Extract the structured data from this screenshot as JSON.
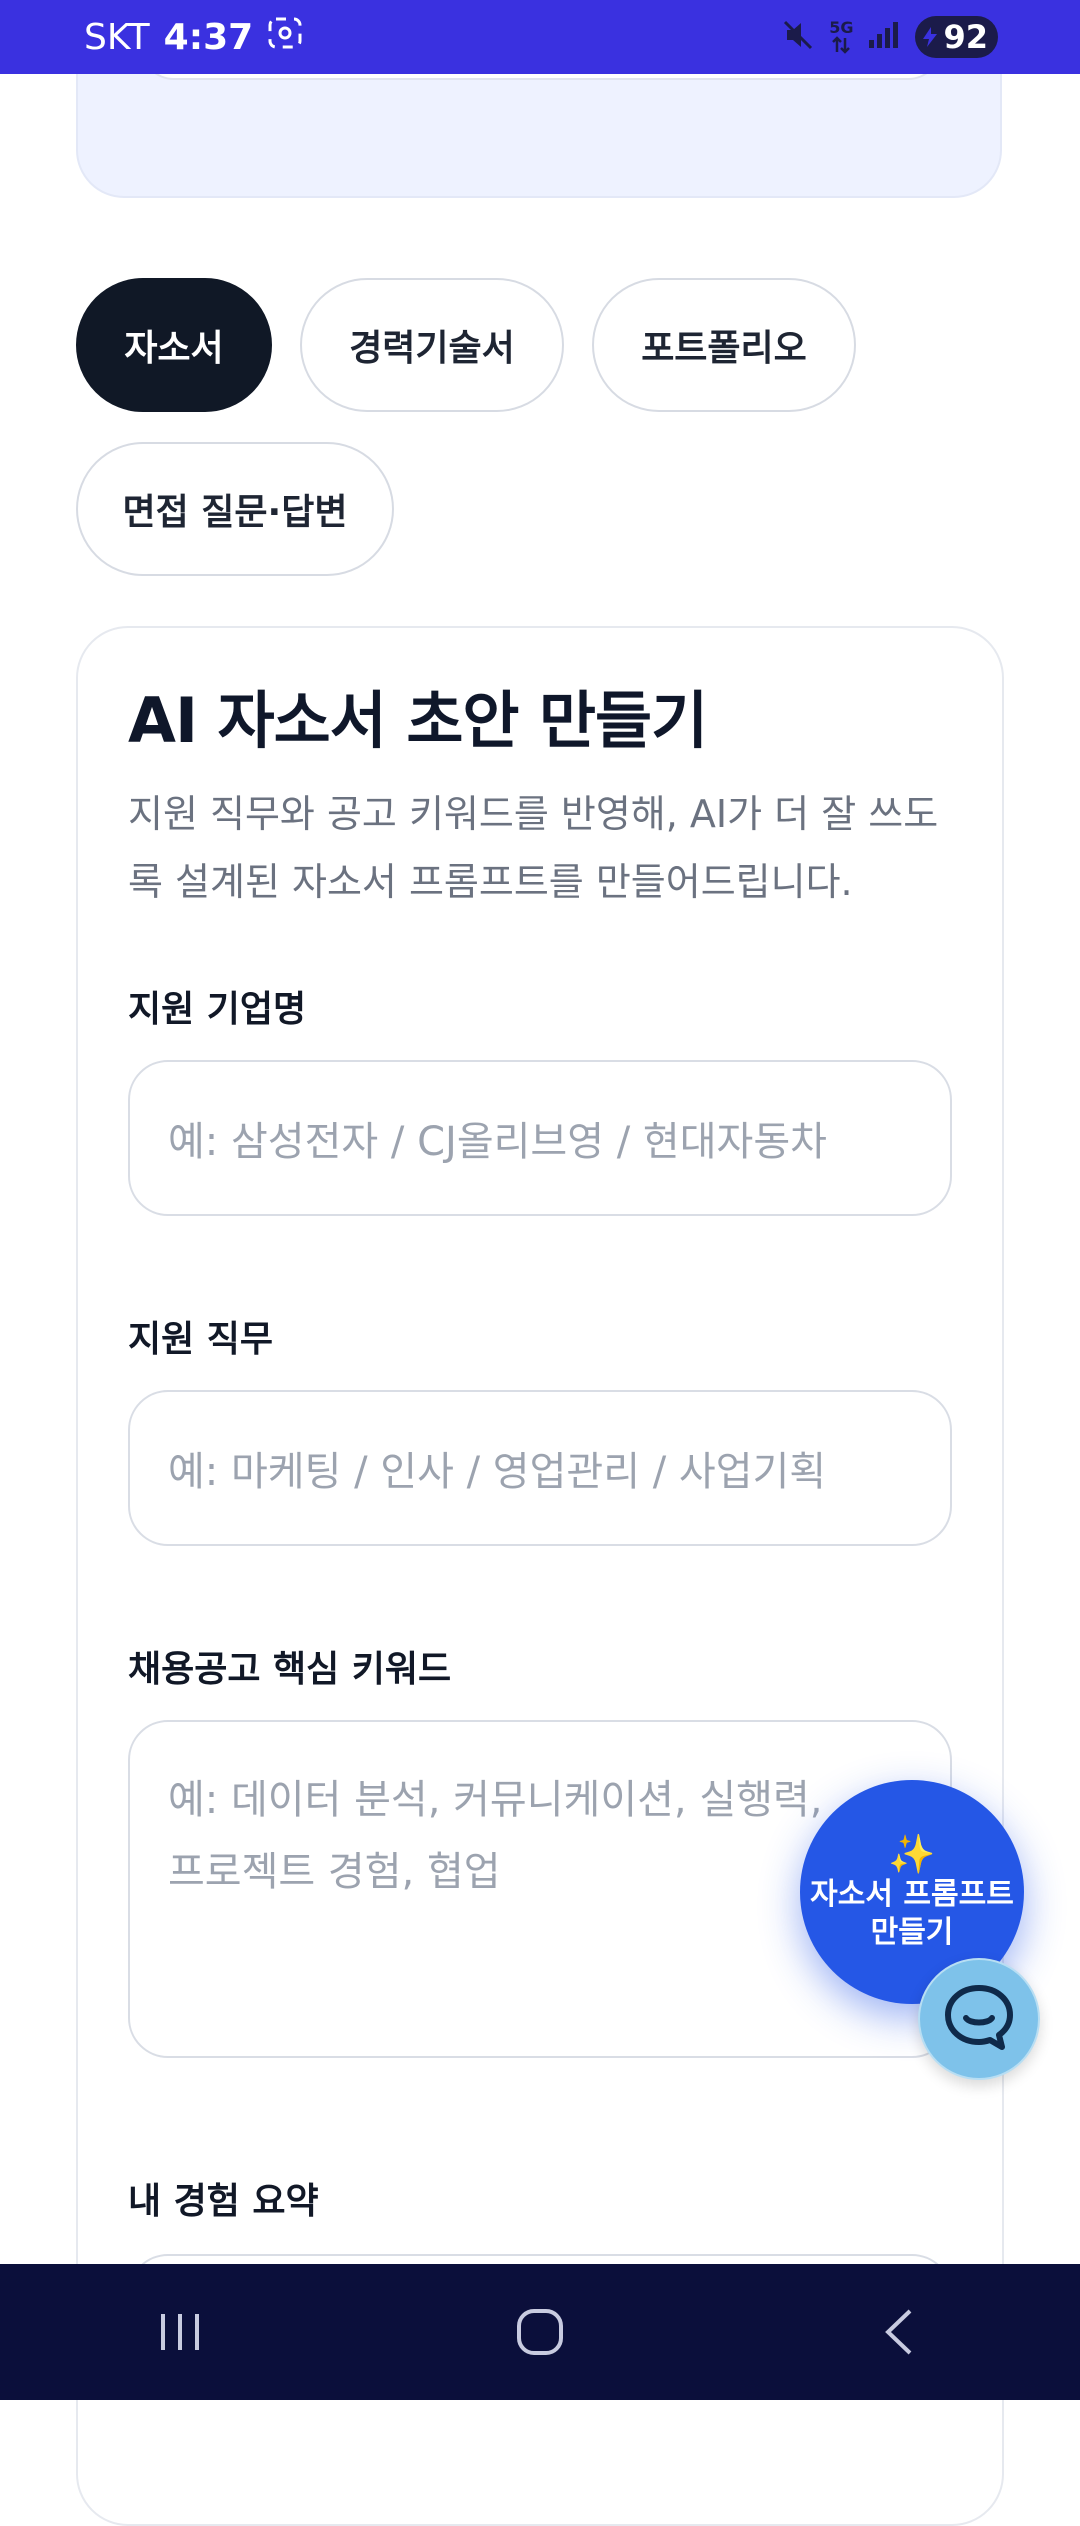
{
  "status_bar": {
    "carrier": "SKT",
    "time": "4:37",
    "network": "5G",
    "battery": "92"
  },
  "tabs": [
    {
      "label": "자소서",
      "active": true
    },
    {
      "label": "경력기술서",
      "active": false
    },
    {
      "label": "포트폴리오",
      "active": false
    },
    {
      "label": "면접 질문·답변",
      "active": false
    }
  ],
  "form": {
    "title": "AI 자소서 초안 만들기",
    "description": "지원 직무와 공고 키워드를 반영해, AI가 더 잘 쓰도록 설계된 자소서 프롬프트를 만들어드립니다.",
    "company": {
      "label": "지원 기업명",
      "placeholder": "예: 삼성전자 / CJ올리브영 / 현대자동차"
    },
    "job": {
      "label": "지원 직무",
      "placeholder": "예: 마케팅 / 인사 / 영업관리 / 사업기획"
    },
    "keywords": {
      "label": "채용공고 핵심 키워드",
      "placeholder": "예: 데이터 분석, 커뮤니케이션, 실행력,\n프로젝트 경험, 협업"
    },
    "experience": {
      "label": "내 경험 요약"
    }
  },
  "fab": {
    "sparkle": "✨",
    "label_line1": "자소서 프롬프트",
    "label_line2": "만들기"
  },
  "colors": {
    "status_bar": "#3a31e0",
    "active_chip": "#101826",
    "fab": "#2557e6",
    "chat_button": "#7ec2ea",
    "nav_bar": "#0b0f3b"
  }
}
